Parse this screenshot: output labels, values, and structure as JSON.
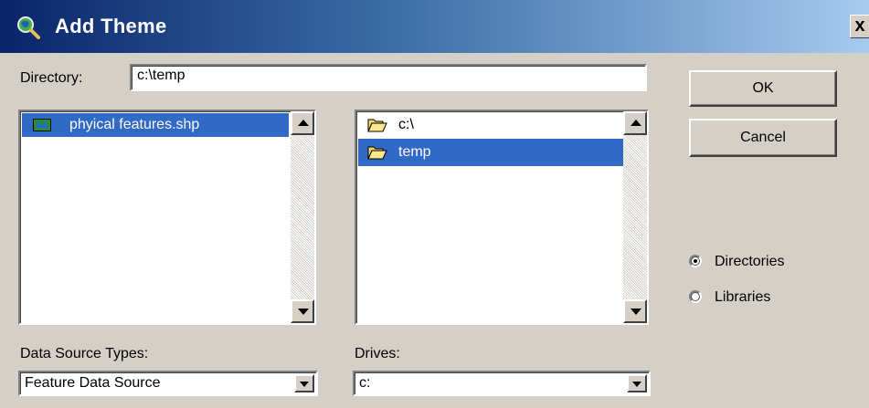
{
  "window": {
    "title": "Add Theme",
    "close_label": "x",
    "title_icon": "magnifier-globe-icon"
  },
  "directory": {
    "label": "Directory:",
    "value": "c:\\temp"
  },
  "buttons": {
    "ok": "OK",
    "cancel": "Cancel"
  },
  "files": {
    "items": [
      {
        "label": "phyical features.shp",
        "icon": "shapefile-icon",
        "selected": true
      }
    ]
  },
  "folders": {
    "items": [
      {
        "label": "c:\\",
        "icon": "open-folder-icon",
        "selected": false
      },
      {
        "label": "temp",
        "icon": "open-folder-icon",
        "selected": true
      }
    ]
  },
  "data_source": {
    "label": "Data Source Types:",
    "selected": "Feature Data Source"
  },
  "drives": {
    "label": "Drives:",
    "selected": "c:"
  },
  "view_mode": {
    "options": [
      {
        "label": "Directories",
        "checked": true
      },
      {
        "label": "Libraries",
        "checked": false
      }
    ]
  },
  "colors": {
    "selection": "#3169c6",
    "dialog_bg": "#d4d0c8",
    "title_start": "#0a246a",
    "title_end": "#a6caf0"
  }
}
